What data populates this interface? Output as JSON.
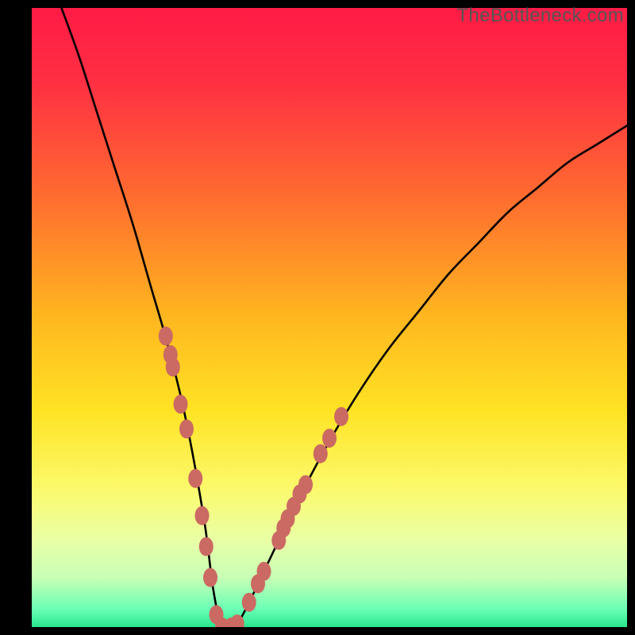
{
  "watermark": "TheBottleneck.com",
  "colors": {
    "gradient_stops": [
      {
        "offset": 0.0,
        "color": "#ff1b45"
      },
      {
        "offset": 0.12,
        "color": "#ff2f43"
      },
      {
        "offset": 0.3,
        "color": "#ff6a30"
      },
      {
        "offset": 0.5,
        "color": "#ffb71f"
      },
      {
        "offset": 0.65,
        "color": "#ffe324"
      },
      {
        "offset": 0.78,
        "color": "#fbfa6e"
      },
      {
        "offset": 0.86,
        "color": "#e9ffa6"
      },
      {
        "offset": 0.92,
        "color": "#c7ffb5"
      },
      {
        "offset": 0.97,
        "color": "#6cffb5"
      },
      {
        "offset": 1.0,
        "color": "#28e78e"
      }
    ],
    "curve": "#000000",
    "marker_fill": "#cb6a63",
    "marker_stroke": "#cb6a63",
    "frame_bg": "#000000"
  },
  "chart_data": {
    "type": "line",
    "title": "",
    "xlabel": "",
    "ylabel": "",
    "xlim": [
      0,
      100
    ],
    "ylim": [
      0,
      100
    ],
    "grid": false,
    "legend": false,
    "series": [
      {
        "name": "bottleneck-curve",
        "x": [
          5,
          8,
          11,
          14,
          17,
          20,
          23,
          26,
          29,
          30.5,
          32,
          34,
          36,
          40,
          45,
          50,
          55,
          60,
          65,
          70,
          75,
          80,
          85,
          90,
          95,
          100
        ],
        "y": [
          100,
          92,
          83,
          74,
          65,
          55,
          45,
          33,
          17,
          6,
          0,
          0,
          3,
          11,
          21,
          30,
          38,
          45,
          51,
          57,
          62,
          67,
          71,
          75,
          78,
          81
        ]
      }
    ],
    "markers": [
      {
        "x": 22.5,
        "y": 47
      },
      {
        "x": 23.3,
        "y": 44
      },
      {
        "x": 23.7,
        "y": 42
      },
      {
        "x": 25.0,
        "y": 36
      },
      {
        "x": 26.0,
        "y": 32
      },
      {
        "x": 27.5,
        "y": 24
      },
      {
        "x": 28.6,
        "y": 18
      },
      {
        "x": 29.3,
        "y": 13
      },
      {
        "x": 30.0,
        "y": 8
      },
      {
        "x": 31.0,
        "y": 2
      },
      {
        "x": 32.0,
        "y": 0
      },
      {
        "x": 33.5,
        "y": 0
      },
      {
        "x": 34.5,
        "y": 0.5
      },
      {
        "x": 36.5,
        "y": 4
      },
      {
        "x": 38.0,
        "y": 7
      },
      {
        "x": 39.0,
        "y": 9
      },
      {
        "x": 41.5,
        "y": 14
      },
      {
        "x": 42.3,
        "y": 16
      },
      {
        "x": 43.0,
        "y": 17.5
      },
      {
        "x": 44.0,
        "y": 19.5
      },
      {
        "x": 45.0,
        "y": 21.5
      },
      {
        "x": 46.0,
        "y": 23
      },
      {
        "x": 48.5,
        "y": 28
      },
      {
        "x": 50.0,
        "y": 30.5
      },
      {
        "x": 52.0,
        "y": 34
      }
    ],
    "marker_size_rx": 9,
    "marker_size_ry": 12
  }
}
